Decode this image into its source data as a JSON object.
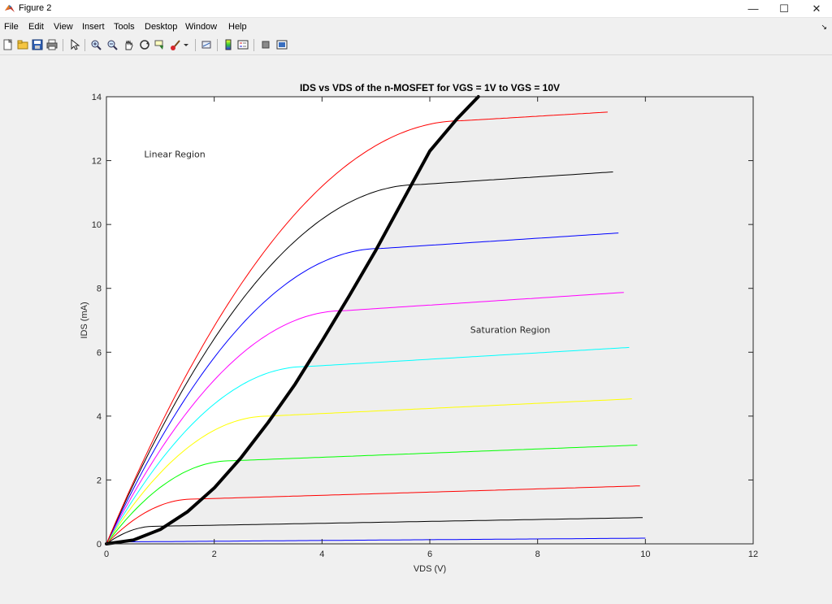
{
  "window": {
    "title": "Figure 2",
    "controls": {
      "minimize": "—",
      "maximize": "☐",
      "close": "✕"
    }
  },
  "menu": {
    "items": [
      "File",
      "Edit",
      "View",
      "Insert",
      "Tools",
      "Desktop",
      "Window",
      "Help"
    ]
  },
  "toolbar": {
    "buttons": [
      "new-figure-icon",
      "open-file-icon",
      "save-icon",
      "print-icon",
      "pointer-icon",
      "zoom-in-icon",
      "zoom-out-icon",
      "pan-icon",
      "rotate-3d-icon",
      "data-cursor-icon",
      "brush-icon",
      "link-plot-icon",
      "colorbar-icon",
      "legend-icon",
      "hide-plot-tools-icon",
      "show-plot-tools-icon"
    ]
  },
  "colors": {
    "figure_bg": "#f0f0f0",
    "axes_bg": "#ffffff",
    "saturation_fill": "#eeeeee",
    "boundary": "#000000"
  },
  "chart_data": {
    "type": "line",
    "title": "IDS vs VDS of the n-MOSFET for VGS = 1V to VGS = 10V",
    "xlabel": "VDS (V)",
    "ylabel": "IDS (mA)",
    "xlim": [
      0,
      12
    ],
    "ylim": [
      0,
      14
    ],
    "xticks": [
      0,
      2,
      4,
      6,
      8,
      10,
      12
    ],
    "yticks": [
      0,
      2,
      4,
      6,
      8,
      10,
      12,
      14
    ],
    "grid": false,
    "legend": "none",
    "annotations": [
      {
        "text": "Linear Region",
        "x": 0.7,
        "y": 12.1
      },
      {
        "text": "Saturation Region",
        "x": 6.75,
        "y": 6.6
      }
    ],
    "series": [
      {
        "color": "#0000ff",
        "vsat": 0.18,
        "isat": 0.06,
        "slope": 0.012,
        "xend": 10.0
      },
      {
        "color": "#000000",
        "vsat": 0.9,
        "isat": 0.55,
        "slope": 0.03,
        "xend": 9.95
      },
      {
        "color": "#ff0000",
        "vsat": 1.6,
        "isat": 1.4,
        "slope": 0.05,
        "xend": 9.9
      },
      {
        "color": "#00ff00",
        "vsat": 2.3,
        "isat": 2.6,
        "slope": 0.065,
        "xend": 9.85
      },
      {
        "color": "#ffff00",
        "vsat": 3.0,
        "isat": 4.0,
        "slope": 0.08,
        "xend": 9.75
      },
      {
        "color": "#00ffff",
        "vsat": 3.7,
        "isat": 5.55,
        "slope": 0.1,
        "xend": 9.7
      },
      {
        "color": "#ff00ff",
        "vsat": 4.4,
        "isat": 7.3,
        "slope": 0.11,
        "xend": 9.6
      },
      {
        "color": "#0000ff",
        "vsat": 5.1,
        "isat": 9.25,
        "slope": 0.11,
        "xend": 9.5
      },
      {
        "color": "#000000",
        "vsat": 5.8,
        "isat": 11.25,
        "slope": 0.11,
        "xend": 9.4
      },
      {
        "color": "#ff0000",
        "vsat": 6.6,
        "isat": 13.25,
        "slope": 0.1,
        "xend": 9.3
      }
    ],
    "boundary": {
      "color": "#000000",
      "points": [
        [
          0,
          0
        ],
        [
          0.5,
          0.12
        ],
        [
          1.0,
          0.45
        ],
        [
          1.5,
          1.0
        ],
        [
          2.0,
          1.75
        ],
        [
          2.5,
          2.7
        ],
        [
          3.0,
          3.8
        ],
        [
          3.5,
          5.0
        ],
        [
          4.0,
          6.35
        ],
        [
          4.5,
          7.75
        ],
        [
          5.0,
          9.2
        ],
        [
          5.5,
          10.75
        ],
        [
          6.0,
          12.3
        ],
        [
          6.5,
          13.3
        ],
        [
          6.9,
          14.0
        ]
      ]
    }
  }
}
